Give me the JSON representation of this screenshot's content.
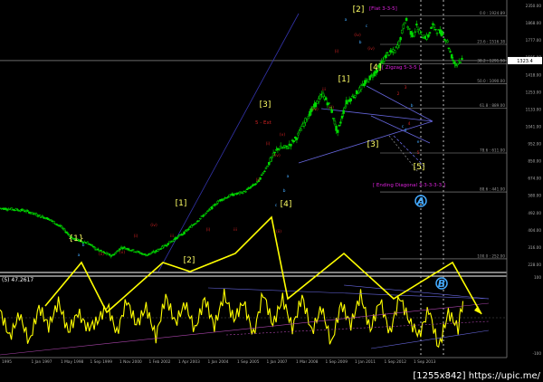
{
  "window": {
    "watermark": "[1255x842] https://upic.me/"
  },
  "chart_data": {
    "type": "line",
    "subtype": "candlestick-with-oscillator",
    "title": "",
    "grid": false,
    "background": "#000000",
    "colors": {
      "candle": "#00dd00",
      "oscillator": "#ffff00",
      "projection": "#ffff00",
      "wave_major": "#ffff66",
      "wave_minor": "#cc2222",
      "wave_sub": "#44aaff",
      "channel": "#6666dd",
      "target": "#7777cc",
      "fib_level": "#999999",
      "magenta_text": "#dd22dd",
      "axis_text": "#aaaaaa",
      "price_tag": "#ffffff"
    },
    "x_axis": {
      "ticks": [
        "1995",
        "1 Jan 1997",
        "1 May 1998",
        "1 Sep 1999",
        "1 Nov 2000",
        "1 Feb 2002",
        "1 Apr 2003",
        "1 Jan 2004",
        "1 Sep 2005",
        "1 Jan 2007",
        "1 Mar 2008",
        "1 Sep 2009",
        "1 Jan 2011",
        "1 Sep 2012",
        "1 Sep 2013"
      ]
    },
    "y_axis": {
      "scale": "log",
      "range": [
        230,
        2100
      ],
      "ticks": [
        2350.0,
        1868.0,
        1777.0,
        1595.0,
        1418.0,
        1253.0,
        1133.0,
        1041.0,
        952.0,
        850.0,
        674.0,
        580.0,
        492.0,
        404.0,
        316.0,
        228.0
      ],
      "current_price": 1323.4
    },
    "fib_levels": [
      {
        "label": "0.0 : 1924.89",
        "value": 1924.89
      },
      {
        "label": "23.6 : 1516.38",
        "value": 1516.38
      },
      {
        "label": "38.2 : 1291.50",
        "value": 1291.5
      },
      {
        "label": "50.0 : 1090.00",
        "value": 1090.0
      },
      {
        "label": "61.8 : 889.00",
        "value": 889.0
      },
      {
        "label": "78.6 : 611.00",
        "value": 611.0
      },
      {
        "label": "88.6 : 441.00",
        "value": 441.0
      },
      {
        "label": "100.0 : 252.00",
        "value": 252.0
      }
    ],
    "price_series": {
      "name": "",
      "x": [
        1995.0,
        1996.0,
        1997.0,
        1997.5,
        1998.0,
        1998.6,
        1999.0,
        1999.6,
        2000.0,
        2000.5,
        2001.0,
        2001.4,
        2002.0,
        2002.6,
        2003.0,
        2003.5,
        2004.0,
        2004.5,
        2005.0,
        2005.6,
        2006.0,
        2006.4,
        2006.8,
        2007.2,
        2007.6,
        2008.0,
        2008.25,
        2008.6,
        2008.85,
        2009.2,
        2009.6,
        2010.0,
        2010.5,
        2010.9,
        2011.2,
        2011.4,
        2011.65,
        2011.75,
        2011.95,
        2012.1,
        2012.3,
        2012.55,
        2012.75,
        2012.95,
        2013.15,
        2013.35,
        2013.5,
        2013.7,
        2013.85,
        2014.0
      ],
      "y": [
        385,
        378,
        352,
        330,
        298,
        288,
        272,
        258,
        278,
        270,
        260,
        268,
        290,
        315,
        340,
        372,
        410,
        430,
        440,
        480,
        555,
        635,
        640,
        700,
        820,
        930,
        1000,
        880,
        720,
        930,
        1000,
        1100,
        1230,
        1400,
        1430,
        1550,
        1890,
        1750,
        1620,
        1760,
        1640,
        1600,
        1780,
        1700,
        1660,
        1560,
        1400,
        1270,
        1330,
        1323
      ]
    },
    "oscillator": {
      "label": "(5) 47.2617",
      "range": [
        -100,
        100
      ],
      "levels": [
        100,
        0,
        -100
      ],
      "x": [
        1995.0,
        1995.4,
        1995.8,
        1996.2,
        1996.6,
        1997.0,
        1997.4,
        1997.8,
        1998.2,
        1998.6,
        1999.0,
        1999.4,
        1999.8,
        2000.2,
        2000.6,
        2001.0,
        2001.4,
        2001.8,
        2002.2,
        2002.6,
        2003.0,
        2003.4,
        2003.8,
        2004.2,
        2004.6,
        2005.0,
        2005.4,
        2005.8,
        2006.2,
        2006.6,
        2007.0,
        2007.4,
        2007.8,
        2008.2,
        2008.6,
        2009.0,
        2009.4,
        2009.8,
        2010.2,
        2010.6,
        2011.0,
        2011.4,
        2011.8,
        2012.2,
        2012.6,
        2013.0,
        2013.4,
        2013.8,
        2014.0
      ],
      "y": [
        20,
        -55,
        10,
        -70,
        30,
        -25,
        45,
        -40,
        15,
        -30,
        -10,
        35,
        -45,
        50,
        -20,
        30,
        -55,
        60,
        -15,
        40,
        -35,
        55,
        -25,
        65,
        -5,
        45,
        -50,
        70,
        -20,
        55,
        -30,
        60,
        -40,
        30,
        -75,
        40,
        -20,
        65,
        -35,
        50,
        -45,
        60,
        -10,
        -50,
        25,
        -85,
        15,
        -30,
        47.26
      ]
    },
    "projection": {
      "name": "projection",
      "x": [
        1996.5,
        1997.6,
        1998.9,
        2000.2,
        2001.6,
        2003.0,
        2004.6,
        2006.2,
        2007.6,
        2009.0,
        2010.6,
        2012.2,
        2013.6,
        2015.0
      ],
      "y": [
        null,
        null,
        null,
        null,
        null,
        null,
        null,
        null,
        null,
        null,
        null,
        null,
        null,
        null
      ]
    },
    "annotations": [
      {
        "text": "[1]",
        "level": "major"
      },
      {
        "text": "[2]",
        "level": "major"
      },
      {
        "text": "[3]",
        "level": "major"
      },
      {
        "text": "[4]",
        "level": "major"
      },
      {
        "text": "[5]",
        "level": "major"
      },
      {
        "text": "{1}",
        "level": "major"
      },
      {
        "text": "[Flat 3-3-5]",
        "level": "label"
      },
      {
        "text": "[ Zigzag 5-3-5 ]",
        "level": "label"
      },
      {
        "text": "[ Ending Diagonal 3-3-3-3-3 ]",
        "level": "label"
      },
      {
        "text": "5 - Ext",
        "level": "label"
      }
    ]
  }
}
